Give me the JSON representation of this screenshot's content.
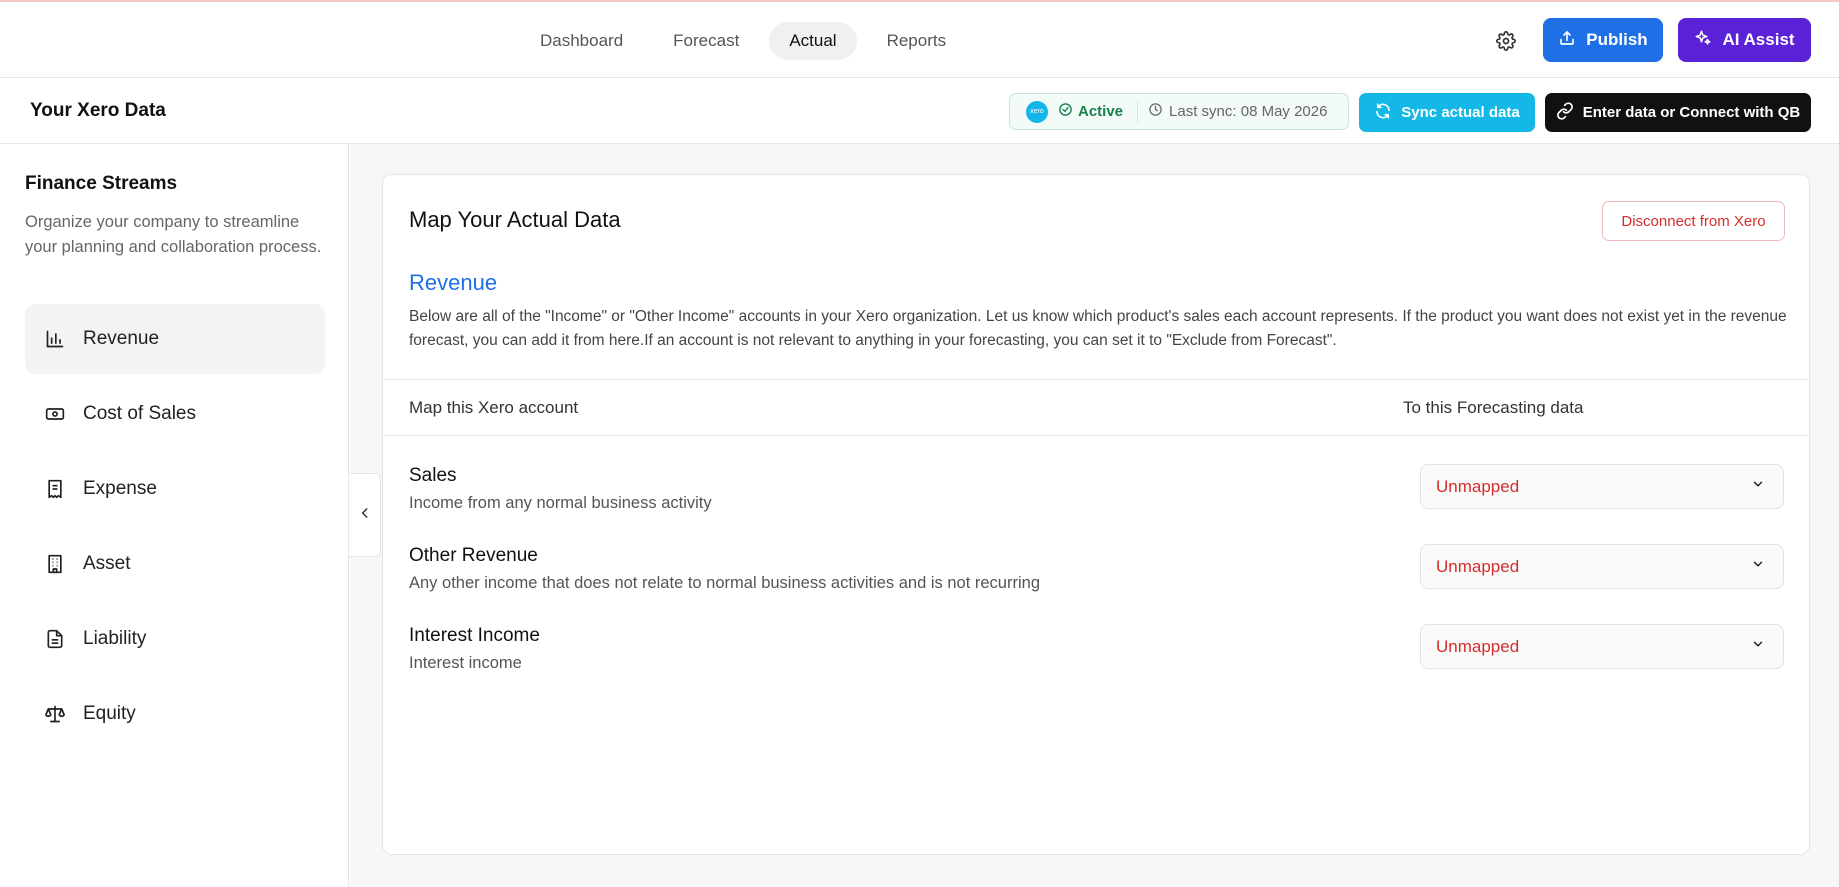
{
  "nav": {
    "tabs": [
      {
        "label": "Dashboard",
        "active": false
      },
      {
        "label": "Forecast",
        "active": false
      },
      {
        "label": "Actual",
        "active": true
      },
      {
        "label": "Reports",
        "active": false
      }
    ],
    "publish_label": "Publish",
    "ai_label": "AI Assist",
    "settings_icon": "gear-icon"
  },
  "header": {
    "title": "Your Xero Data",
    "xero_logo_text": "xero",
    "status": "Active",
    "last_sync": "Last sync: 08 May 2026",
    "sync_label": "Sync actual data",
    "enter_label": "Enter data or Connect with QB"
  },
  "sidebar": {
    "title": "Finance Streams",
    "description": "Organize your company to streamline your planning and collaboration process.",
    "items": [
      {
        "label": "Revenue",
        "icon": "bar-chart-icon",
        "active": true
      },
      {
        "label": "Cost of Sales",
        "icon": "cash-icon",
        "active": false
      },
      {
        "label": "Expense",
        "icon": "receipt-icon",
        "active": false
      },
      {
        "label": "Asset",
        "icon": "building-icon",
        "active": false
      },
      {
        "label": "Liability",
        "icon": "document-icon",
        "active": false
      },
      {
        "label": "Equity",
        "icon": "scale-icon",
        "active": false
      }
    ]
  },
  "main": {
    "card_title": "Map Your Actual Data",
    "disconnect_label": "Disconnect from Xero",
    "section_title": "Revenue",
    "section_description": "Below are all of the \"Income\" or \"Other Income\" accounts in your Xero organization. Let us know which product's sales each account represents. If the product you want does not exist yet in the revenue forecast, you can add it from here.If an account is not relevant to anything in your forecasting, you can set it to \"Exclude from Forecast\".",
    "columns": [
      "Map this Xero account",
      "To this Forecasting data"
    ],
    "rows": [
      {
        "name": "Sales",
        "description": "Income from any normal business activity",
        "mapping": "Unmapped"
      },
      {
        "name": "Other Revenue",
        "description": "Any other income that does not relate to normal business activities and is not recurring",
        "mapping": "Unmapped"
      },
      {
        "name": "Interest Income",
        "description": "Interest income",
        "mapping": "Unmapped"
      }
    ]
  },
  "colors": {
    "publish": "#1f6fe6",
    "ai_assist": "#5b21d6",
    "sync": "#14b8e6",
    "unmapped": "#d62c2c",
    "active_status": "#1a7f4f"
  }
}
